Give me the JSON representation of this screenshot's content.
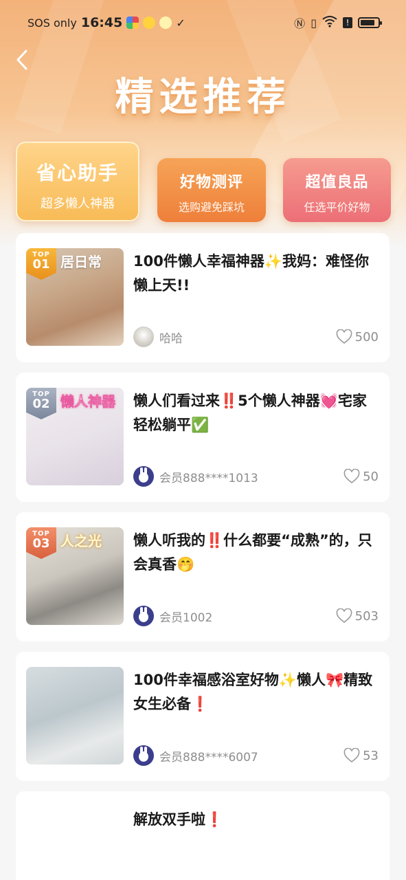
{
  "status_bar": {
    "carrier": "SOS only",
    "time": "16:45",
    "app_icon_colors": [
      "#6b8cff",
      "#ffd23f",
      "#222222"
    ],
    "right_icons": [
      "nfc-icon",
      "vibrate-icon",
      "wifi-icon",
      "alert-icon",
      "battery-icon"
    ],
    "wifi_label": "6",
    "battery_level": 0.85
  },
  "header": {
    "back_icon": "chevron-left-icon",
    "title": "精选推荐"
  },
  "tabs": [
    {
      "title": "省心助手",
      "subtitle": "超多懒人神器",
      "active": true
    },
    {
      "title": "好物测评",
      "subtitle": "选购避免踩坑",
      "active": false
    },
    {
      "title": "超值良品",
      "subtitle": "任选平价好物",
      "active": false
    }
  ],
  "articles": [
    {
      "rank": "01",
      "rank_label": "TOP",
      "thumb_text": "居日常",
      "title": "100件懒人幸福神器✨我妈：难怪你懒上天!!",
      "author": "哈哈",
      "likes": "500"
    },
    {
      "rank": "02",
      "rank_label": "TOP",
      "thumb_text": "懒人神器",
      "title": "懒人们看过来‼️5个懒人神器💓宅家轻松躺平✅",
      "author": "会员888****1013",
      "likes": "50"
    },
    {
      "rank": "03",
      "rank_label": "TOP",
      "thumb_text": "人之光",
      "title": "懒人听我的‼️什么都要“成熟”的，只会真香🤭",
      "author": "会员1002",
      "likes": "503"
    },
    {
      "rank": "",
      "rank_label": "",
      "thumb_text": "",
      "title": "100件幸福感浴室好物✨懒人🎀精致女生必备❗",
      "author": "会员888****6007",
      "likes": "53"
    },
    {
      "title": "解放双手啦❗"
    }
  ],
  "colors": {
    "accent_orange": "#ee7f3a",
    "accent_gold": "#f8bb57",
    "accent_pink": "#ec6f77",
    "like_gray": "#8e8e8e"
  }
}
